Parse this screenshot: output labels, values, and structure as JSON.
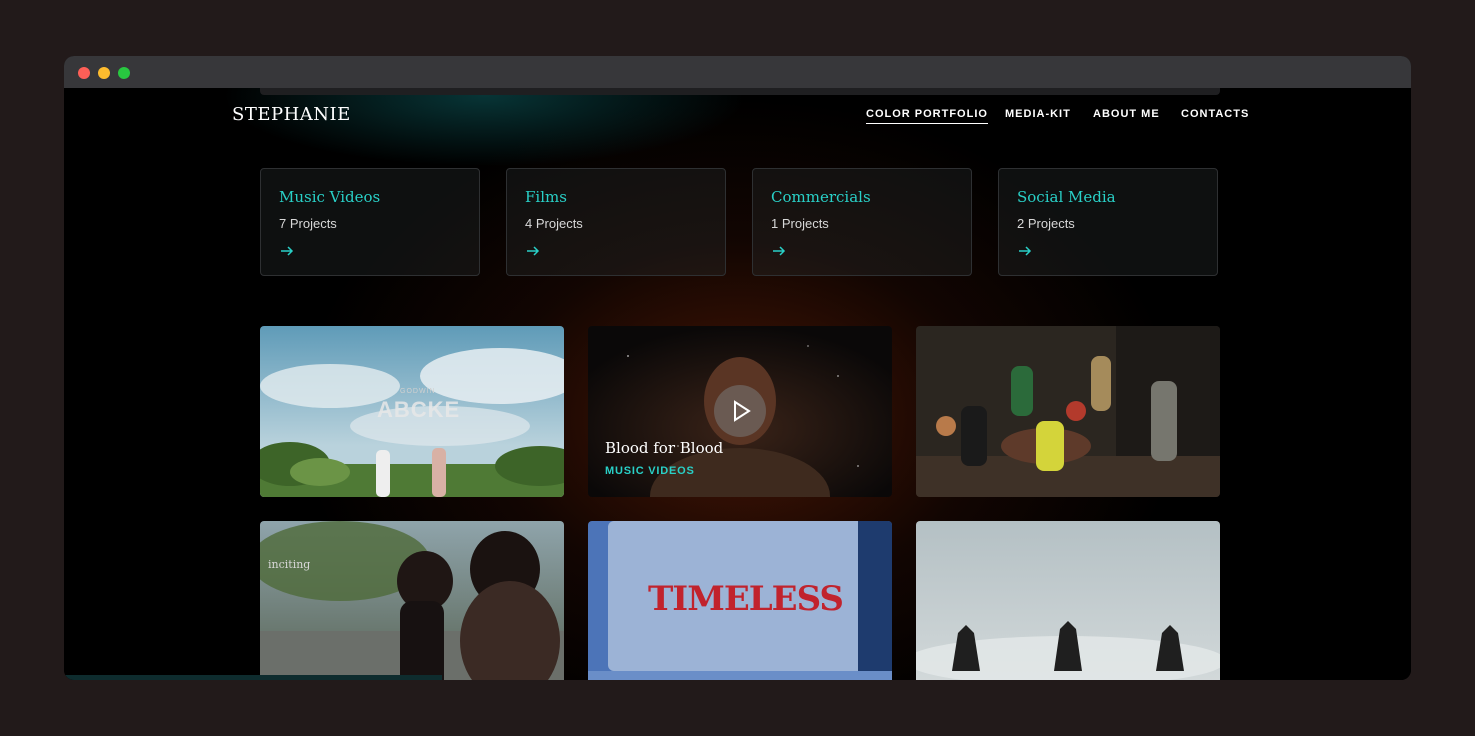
{
  "site": {
    "logo": "STEPHANIE",
    "nav": [
      {
        "label": "COLOR PORTFOLIO",
        "active": true
      },
      {
        "label": "MEDIA-KIT",
        "active": false
      },
      {
        "label": "ABOUT ME",
        "active": false
      },
      {
        "label": "CONTACTS",
        "active": false
      }
    ]
  },
  "categories": [
    {
      "title": "Music Videos",
      "count": "7 Projects"
    },
    {
      "title": "Films",
      "count": "4 Projects"
    },
    {
      "title": "Commercials",
      "count": "1 Projects"
    },
    {
      "title": "Social Media",
      "count": "2 Projects"
    }
  ],
  "projects": [
    {
      "overlay_small": "GODWIN",
      "overlay_big": "ABCKE"
    },
    {
      "title": "Blood for Blood",
      "tag": "MUSIC VIDEOS"
    },
    {},
    {
      "overlay_title": "inciting"
    },
    {
      "overlay_big": "TIMELESS"
    },
    {}
  ],
  "colors": {
    "accent": "#29d0c7",
    "window_bg": "#000000",
    "page_bg": "#221a1a"
  },
  "icons": [
    "arrow-right-icon",
    "play-icon"
  ]
}
